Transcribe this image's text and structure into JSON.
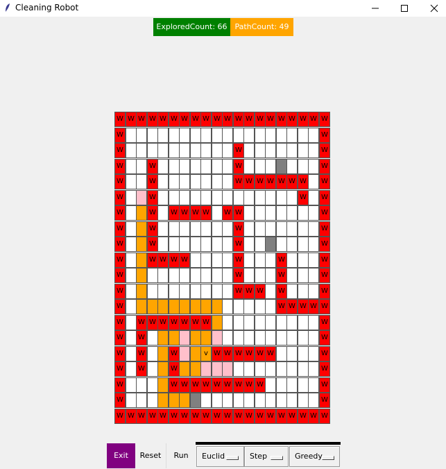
{
  "window": {
    "title": "Cleaning Robot"
  },
  "counters": {
    "explored": "ExploredCount: 66",
    "path": "PathCount: 49"
  },
  "controls": {
    "exit": "Exit",
    "reset": "Reset",
    "run": "Run",
    "heuristic": "Euclid",
    "mode": "Step",
    "algorithm": "Greedy"
  },
  "grid": {
    "legend": {
      "W": "wall",
      "P": "path",
      "E": "explored",
      "O": "obstacle",
      "R": "robot",
      ".": "empty"
    },
    "wall_text": "W",
    "robot_text": "v",
    "colors": {
      "wall": "#ff0000",
      "path": "#ffa500",
      "explored": "#ffc0cb",
      "obstacle": "#808080",
      "empty": "#ffffff"
    },
    "rows": [
      "WWWWWWWWWWWWWWWWWWWW",
      "W..................W",
      "W..........W.......W",
      "W..W.......W...O...W",
      "W..W.......WWWWWWW.W",
      "W.EW.............W.W",
      "W.PW.WWWW.WW.......W",
      "W.PW.......W.......W",
      "W.PW.......W..O....W",
      "W.PWWWW....W...W...W",
      "W.P........W...W...W",
      "W.P........WWW.W...W",
      "W.PPPPPPPP.....WWWWW",
      "W.WWWWWWWP.........W",
      "W.W.PPEPPE.........W",
      "W.W.PWEPRWWWWWW....W",
      "W.W.PWPPEEE........W",
      "W...PWWWWWWWWW.....W",
      "W...PPPO...........W",
      "WWWWWWWWWWWWWWWWWWWW"
    ]
  }
}
